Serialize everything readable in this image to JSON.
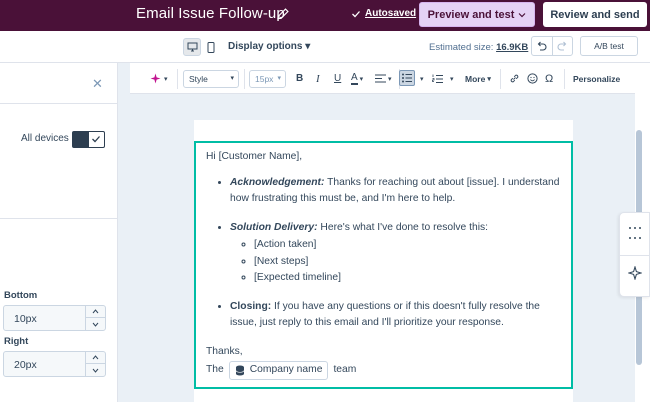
{
  "header": {
    "title": "Email Issue Follow-up",
    "autosaved": "Autosaved",
    "preview_label": "Preview and test",
    "review_label": "Review and send"
  },
  "subbar": {
    "display_options": "Display options",
    "estimated_size_label": "Estimated size:",
    "estimated_size_value": "16.9KB",
    "ab_test_label": "A/B test"
  },
  "leftpanel": {
    "all_devices_label": "All devices",
    "bottom_label": "Bottom",
    "bottom_value": "10px",
    "right_label": "Right",
    "right_value": "20px"
  },
  "toolbar": {
    "style_select": "Style",
    "size_select": "15px",
    "bold": "B",
    "italic": "I",
    "underline": "U",
    "font_color": "A",
    "more_label": "More",
    "personalize_label": "Personalize"
  },
  "email": {
    "greeting": "Hi [Customer Name],",
    "item1_title": "Acknowledgement:",
    "item1_text": " Thanks for reaching out about [issue]. I understand how frustrating this must be, and I'm here to help.",
    "item2_title": "Solution Delivery:",
    "item2_text": " Here's what I've done to resolve this:",
    "sub_items": [
      "[Action taken]",
      "[Next steps]",
      "[Expected timeline]"
    ],
    "item3_title": "Closing:",
    "item3_text": " If you have any questions or if this doesn't fully resolve the issue, just reply to this email and I'll prioritize your response.",
    "thanks": "Thanks,",
    "team_prefix": "The",
    "company_token": "Company name",
    "team_suffix": "team"
  },
  "colors": {
    "header_bg": "#4a1138",
    "preview_bg": "#e5d2f5",
    "selection_border": "#00bda5",
    "editor_bg": "#eaf0f6"
  }
}
